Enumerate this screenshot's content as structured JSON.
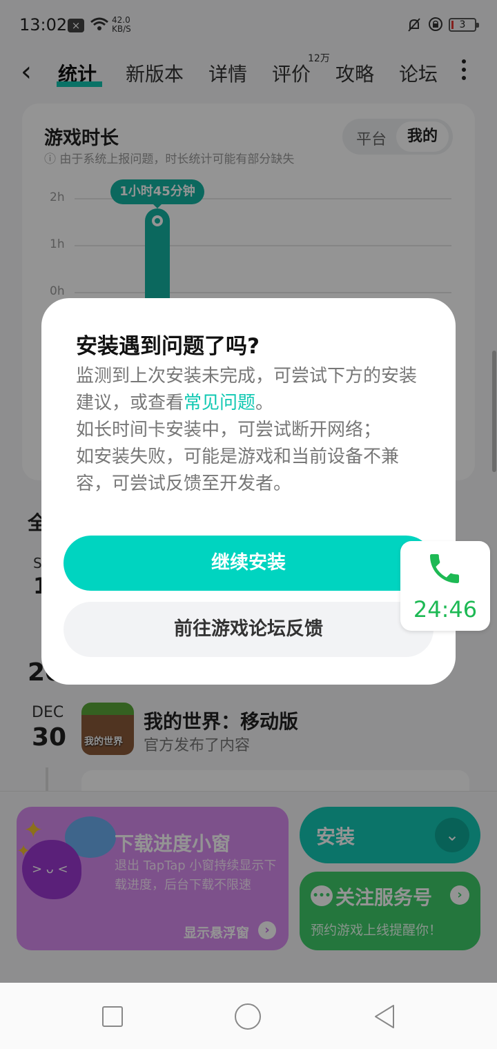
{
  "status_bar": {
    "time": "13:02",
    "speed_value": "42.0",
    "speed_unit": "KB/S",
    "battery": "3"
  },
  "nav": {
    "tabs": [
      "统计",
      "新版本",
      "详情",
      "评价",
      "攻略",
      "论坛"
    ],
    "active_tab": "统计",
    "review_count": "12万"
  },
  "stats_card": {
    "title": "游戏时长",
    "note": "由于系统上报问题，时长统计可能有部分缺失",
    "segment": [
      "平台",
      "我的"
    ],
    "segment_selected": "我的",
    "axis": [
      "2h",
      "1h",
      "0h"
    ],
    "bubble": "1小时45分钟"
  },
  "background_fragments": {
    "section_char": "全",
    "month_s": "S",
    "day_1": "1",
    "year_prefix": "20"
  },
  "timeline_item": {
    "month": "DEC",
    "day": "30",
    "game_title": "我的世界：移动版",
    "subtitle": "官方发布了内容",
    "icon_text": "我的世界"
  },
  "promo": {
    "title": "下载进度小窗",
    "desc": "退出 TapTap 小窗持续显示下载进度，后台下载不限速",
    "link": "显示悬浮窗"
  },
  "install_button": {
    "label": "安装"
  },
  "follow": {
    "title": "关注服务号",
    "subtitle": "预约游戏上线提醒你！"
  },
  "dialog": {
    "title": "安装遇到问题了吗?",
    "body_part1": "监测到上次安装未完成，可尝试下方的安装建议，或查看",
    "body_link": "常见问题",
    "body_part2": "。",
    "body_line2": "如长时间卡安装中，可尝试断开网络；",
    "body_line3": "如安装失败，可能是游戏和当前设备不兼容，可尝试反馈至开发者。",
    "primary": "继续安装",
    "secondary": "前往游戏论坛反馈"
  },
  "call": {
    "duration": "24:46"
  },
  "colors": {
    "accent": "#00d4c0",
    "chart_bar": "#14b4a2",
    "follow_green": "#3fcb69",
    "promo_purple": "#d88cf0",
    "call_green": "#1db954"
  }
}
